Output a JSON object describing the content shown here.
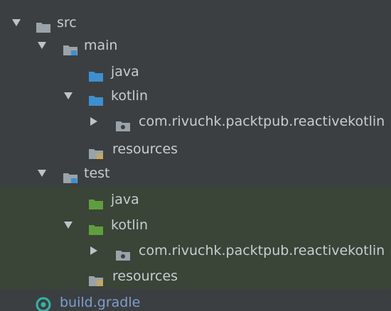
{
  "project_tree": {
    "src": {
      "label": "src"
    },
    "main": {
      "label": "main",
      "java": {
        "label": "java"
      },
      "kotlin": {
        "label": "kotlin",
        "package": {
          "label": "com.rivuchk.packtpub.reactivekotlin"
        }
      },
      "resources": {
        "label": "resources"
      }
    },
    "test": {
      "label": "test",
      "java": {
        "label": "java"
      },
      "kotlin": {
        "label": "kotlin",
        "package": {
          "label": "com.rivuchk.packtpub.reactivekotlin"
        }
      },
      "resources": {
        "label": "resources"
      }
    },
    "build_gradle": {
      "label": "build.gradle"
    }
  },
  "icons": {
    "folder": "folder-icon",
    "module_folder": "module-folder-icon",
    "source_folder": "source-folder-icon",
    "test_folder": "test-source-folder-icon",
    "package": "package-icon",
    "resources_folder": "resources-folder-icon",
    "gradle_file": "gradle-file-icon"
  },
  "colors": {
    "background": "#3c3f41",
    "test_background": "#3a4437",
    "text": "#c7cdd3",
    "source_folder": "#3d8fd0",
    "test_folder": "#5f9e3e",
    "folder_gray": "#9aa3aa",
    "gradle_link": "#7b9fd0",
    "gradle_icon": "#33b5a5"
  }
}
